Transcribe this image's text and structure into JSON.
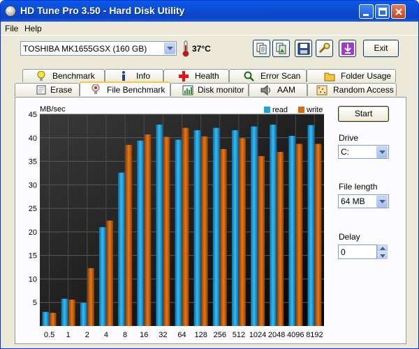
{
  "window": {
    "title": "HD Tune Pro 3.50 - Hard Disk Utility"
  },
  "menu": {
    "file": "File",
    "help": "Help"
  },
  "toolbar": {
    "drive": "TOSHIBA MK1655GSX (160 GB)",
    "temperature": "37°C",
    "exit_label": "Exit"
  },
  "tabs": {
    "top": [
      {
        "label": "Benchmark",
        "icon": "benchmark-icon"
      },
      {
        "label": "Info",
        "icon": "info-icon"
      },
      {
        "label": "Health",
        "icon": "health-icon"
      },
      {
        "label": "Error Scan",
        "icon": "error-scan-icon"
      },
      {
        "label": "Folder Usage",
        "icon": "folder-usage-icon"
      }
    ],
    "bottom": [
      {
        "label": "Erase",
        "icon": "erase-icon"
      },
      {
        "label": "File Benchmark",
        "icon": "file-benchmark-icon",
        "active": true
      },
      {
        "label": "Disk monitor",
        "icon": "disk-monitor-icon"
      },
      {
        "label": "AAM",
        "icon": "aam-icon"
      },
      {
        "label": "Random Access",
        "icon": "random-access-icon"
      }
    ]
  },
  "controls": {
    "start_label": "Start",
    "drive_label": "Drive",
    "drive_value": "C:",
    "file_length_label": "File length",
    "file_length_value": "64 MB",
    "delay_label": "Delay",
    "delay_value": "0"
  },
  "chart_data": {
    "type": "bar",
    "ylabel": "MB/sec",
    "ylim": [
      0,
      45
    ],
    "yticks": [
      5,
      10,
      15,
      20,
      25,
      30,
      35,
      40,
      45
    ],
    "categories": [
      "0.5",
      "1",
      "2",
      "4",
      "8",
      "16",
      "32",
      "64",
      "128",
      "256",
      "512",
      "1024",
      "2048",
      "4096",
      "8192"
    ],
    "series": [
      {
        "name": "read",
        "color": "#1fa3df",
        "values": [
          3.0,
          5.8,
          4.9,
          21.0,
          32.6,
          39.4,
          42.8,
          39.6,
          41.6,
          42.1,
          41.6,
          42.4,
          42.8,
          40.4,
          42.7
        ]
      },
      {
        "name": "write",
        "color": "#d86a10",
        "values": [
          2.8,
          5.6,
          12.3,
          22.4,
          38.5,
          40.7,
          40.2,
          42.1,
          40.3,
          37.6,
          39.9,
          36.1,
          37.0,
          38.7,
          38.7
        ]
      }
    ],
    "legend_position": "top-right",
    "grid": true
  },
  "colors": {
    "titlebar": "#0c4ed6",
    "plot_bg": "#1a1a1a",
    "read": "#1fa3df",
    "write": "#d86a10"
  }
}
